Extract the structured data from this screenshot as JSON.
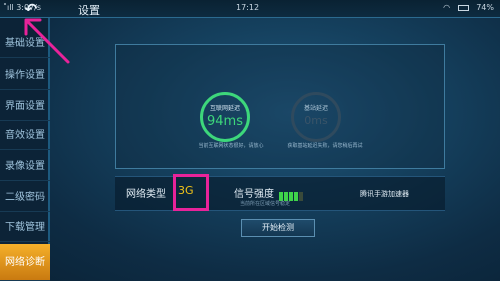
{
  "status": {
    "left_text": "˚ıll 3:07/s",
    "clock": "17:12",
    "battery_text": "74%"
  },
  "header": {
    "title": "设置"
  },
  "sidebar": {
    "items": [
      {
        "label": "基础设置"
      },
      {
        "label": "操作设置"
      },
      {
        "label": "界面设置"
      },
      {
        "label": "音效设置"
      },
      {
        "label": "录像设置"
      },
      {
        "label": "二级密码"
      },
      {
        "label": "下载管理"
      },
      {
        "label": "网络诊断"
      }
    ],
    "active_index": 7
  },
  "diagnostics": {
    "internet_latency": {
      "label": "互联网延迟",
      "value": "94ms",
      "note": "当前互联网状态很好，请放心"
    },
    "base_latency": {
      "label": "基站延迟",
      "value": "0ms",
      "note": "获取基站延迟失败，请您稍后再试"
    }
  },
  "network": {
    "type_label": "网络类型",
    "type_value": "3G",
    "signal_label": "信号强度",
    "signal_level": 0.8,
    "signal_note": "当前所在区域信号稳定",
    "accelerator_label": "腾讯手游加速器"
  },
  "actions": {
    "start_label": "开始检测"
  },
  "colors": {
    "accent_green": "#3dd77b",
    "active_tab": "#f5b02a",
    "highlight": "#e8239a",
    "value_yellow": "#f2c418"
  }
}
